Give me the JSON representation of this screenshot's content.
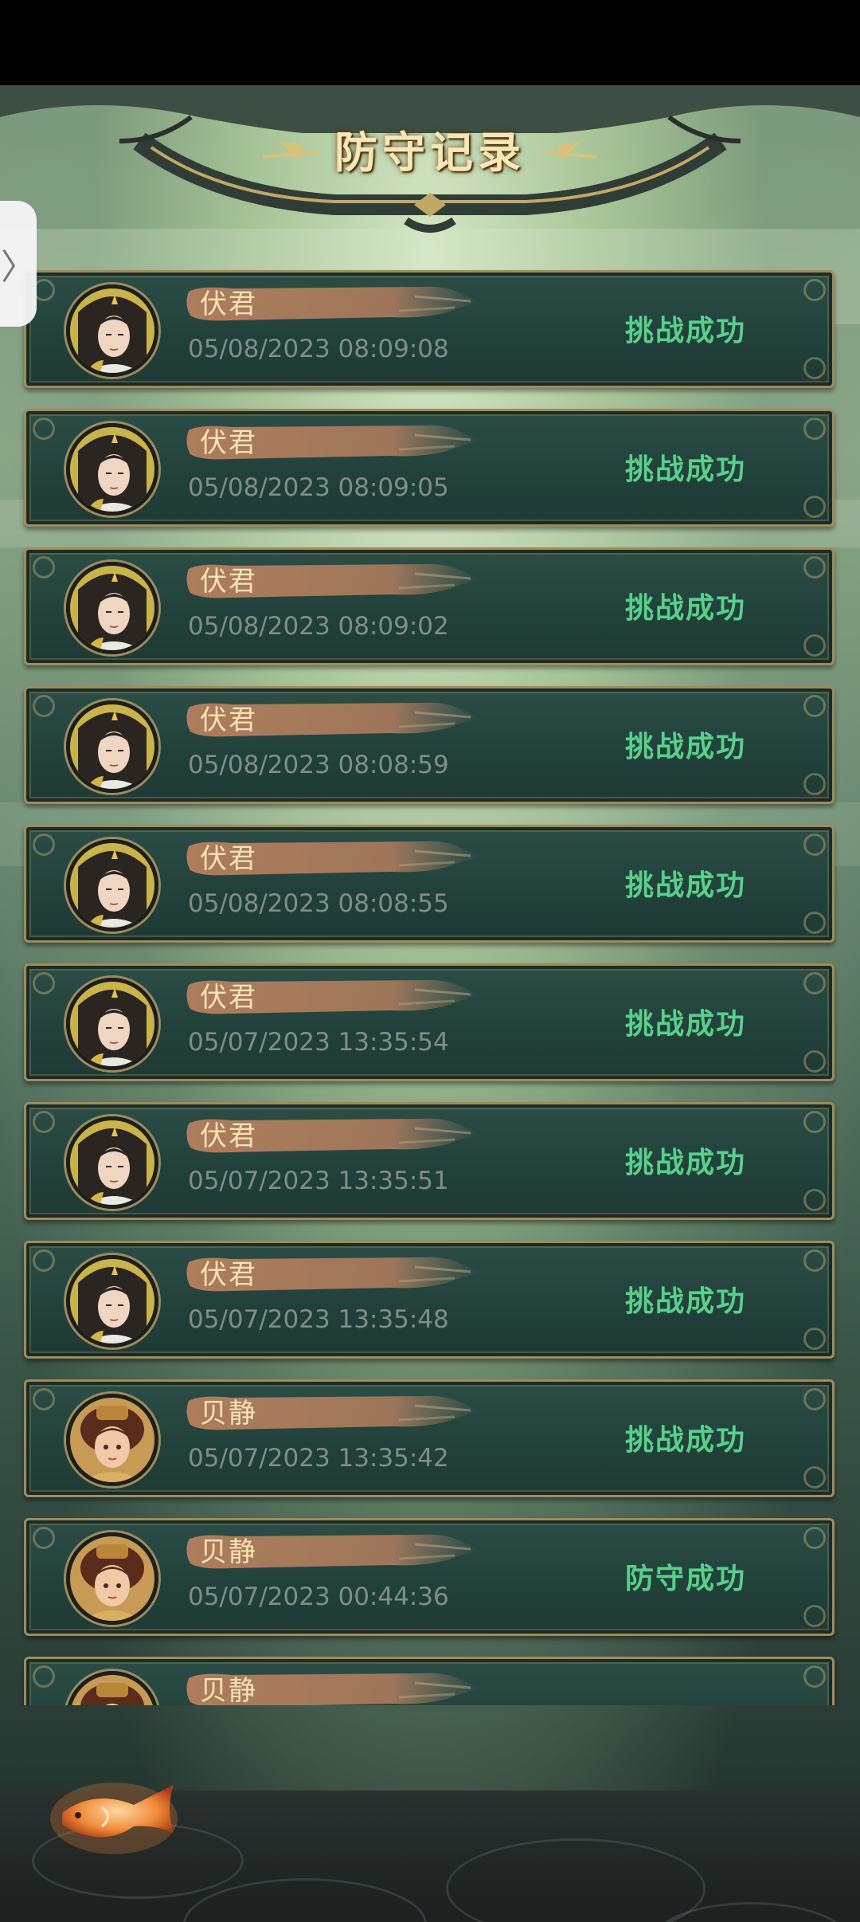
{
  "header": {
    "title": "防守记录"
  },
  "side_tab": {
    "icon": "chevron-right-icon",
    "glyph": "〉"
  },
  "records": [
    {
      "name": "伏君",
      "time": "05/08/2023 08:09:08",
      "result": "挑战成功",
      "avatar": "male-hero-avatar"
    },
    {
      "name": "伏君",
      "time": "05/08/2023 08:09:05",
      "result": "挑战成功",
      "avatar": "male-hero-avatar"
    },
    {
      "name": "伏君",
      "time": "05/08/2023 08:09:02",
      "result": "挑战成功",
      "avatar": "male-hero-avatar"
    },
    {
      "name": "伏君",
      "time": "05/08/2023 08:08:59",
      "result": "挑战成功",
      "avatar": "male-hero-avatar"
    },
    {
      "name": "伏君",
      "time": "05/08/2023 08:08:55",
      "result": "挑战成功",
      "avatar": "male-hero-avatar"
    },
    {
      "name": "伏君",
      "time": "05/07/2023 13:35:54",
      "result": "挑战成功",
      "avatar": "male-hero-avatar"
    },
    {
      "name": "伏君",
      "time": "05/07/2023 13:35:51",
      "result": "挑战成功",
      "avatar": "male-hero-avatar"
    },
    {
      "name": "伏君",
      "time": "05/07/2023 13:35:48",
      "result": "挑战成功",
      "avatar": "male-hero-avatar"
    },
    {
      "name": "贝静",
      "time": "05/07/2023 13:35:42",
      "result": "挑战成功",
      "avatar": "female-hero-avatar"
    },
    {
      "name": "贝静",
      "time": "05/07/2023 00:44:36",
      "result": "防守成功",
      "avatar": "female-hero-avatar"
    },
    {
      "name": "贝静",
      "time": "",
      "result": "",
      "avatar": "female-hero-avatar"
    }
  ],
  "colors": {
    "result_green": "#58d08a",
    "name_gold": "#f6e3b6",
    "card_bg": "#22413b",
    "card_border": "#a08b5a",
    "brush_brown": "#b07a5a"
  },
  "bottom": {
    "koi_icon": "koi-fish-icon"
  }
}
